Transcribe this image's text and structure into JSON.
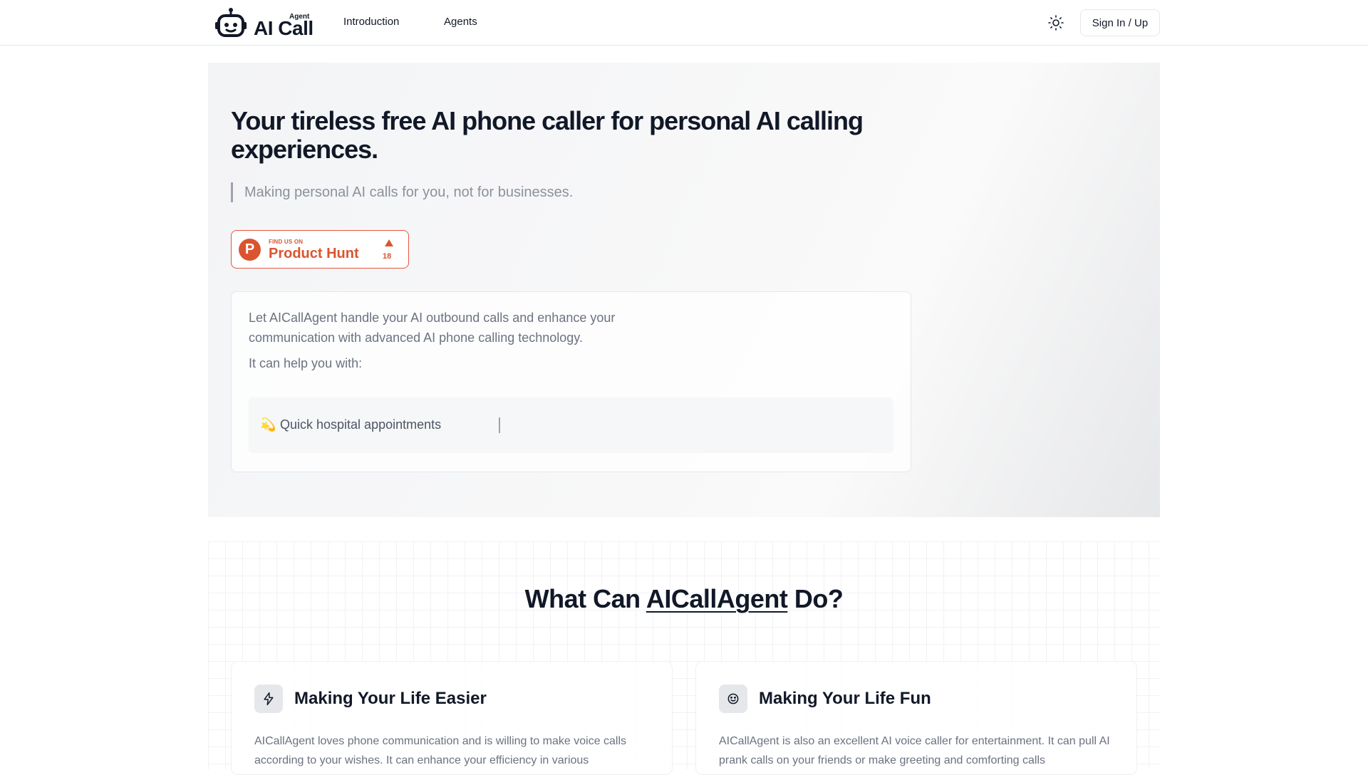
{
  "header": {
    "logo_main": "AI Call",
    "logo_super": "Agent",
    "nav": [
      "Introduction",
      "Agents"
    ],
    "theme_icon": "sun-icon",
    "signin_label": "Sign In / Up"
  },
  "hero": {
    "title": "Your tireless free AI phone caller for personal AI calling experiences.",
    "quote": "Making personal AI calls for you, not for businesses.",
    "product_hunt": {
      "logo_letter": "P",
      "find": "FIND US ON",
      "name": "Product Hunt",
      "count": "18",
      "color": "#da552f"
    },
    "card": {
      "text": "Let AICallAgent handle your AI outbound calls and enhance your communication with advanced AI phone calling technology.",
      "help": "It can help you with:",
      "typing_emoji": "💫",
      "typing_text": "Quick hospital appointments"
    }
  },
  "features": {
    "title_prefix": "What Can ",
    "title_highlight": "AICallAgent",
    "title_suffix": " Do?",
    "cards": [
      {
        "icon": "lightning-icon",
        "title": "Making Your Life Easier",
        "text": "AICallAgent loves phone communication and is willing to make voice calls according to your wishes. It can enhance your efficiency in various"
      },
      {
        "icon": "smile-icon",
        "title": "Making Your Life Fun",
        "text": "AICallAgent is also an excellent AI voice caller for entertainment. It can pull AI prank calls on your friends or make greeting and comforting calls"
      }
    ]
  }
}
